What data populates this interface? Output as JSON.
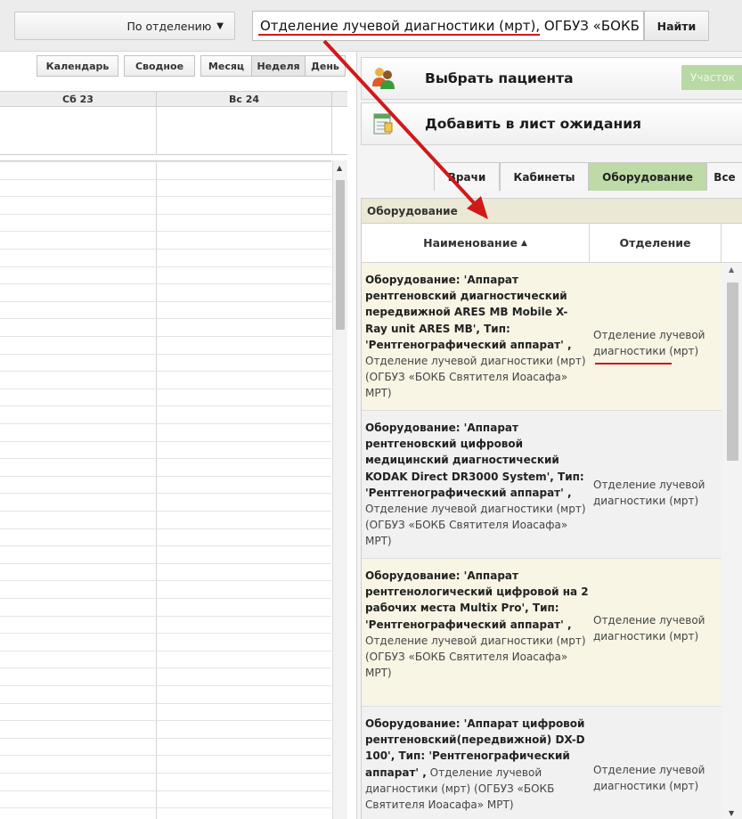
{
  "toolbar": {
    "dept_dropdown_label": "По отделению",
    "search_value": "Отделение лучевой диагностики (мрт), ОГБУЗ «БОКБ Святителя Иоасафа»",
    "find_label": "Найти"
  },
  "calendar": {
    "view_tabs": [
      "Календарь",
      "Сводное",
      "Месяц",
      "Неделя",
      "День"
    ],
    "days": [
      "Сб 23",
      "Вс 24"
    ]
  },
  "panel": {
    "select_patient": "Выбрать пациента",
    "uchastok": "Участок",
    "add_waitlist": "Добавить в лист ожидания",
    "tabs": [
      "Врачи",
      "Кабинеты",
      "Оборудование",
      "Все"
    ],
    "table_caption": "Оборудование",
    "columns": [
      "Наименование",
      "Отделение"
    ],
    "rows": [
      {
        "name": "Оборудование: 'Аппарат рентгеновский диагностический передвижной ARES MB Mobile X-Ray unit ARES MB', Тип: 'Рентгенографический аппарат' ,",
        "sub": "Отделение лучевой диагностики (мрт) (ОГБУЗ «БОКБ Святителя Иоасафа» МРТ)",
        "dept": "Отделение лучевой диагностики (мрт)"
      },
      {
        "name": "Оборудование: 'Аппарат рентгеновский цифровой медицинский диагностический KODAK Direct DR3000 System', Тип: 'Рентгенографический аппарат' ,",
        "sub": "Отделение лучевой диагностики (мрт) (ОГБУЗ «БОКБ Святителя Иоасафа» МРТ)",
        "dept": "Отделение лучевой диагностики (мрт)"
      },
      {
        "name": "Оборудование: 'Аппарат рентгенологический цифровой на 2 рабочих места Multix Pro', Тип: 'Рентгенографический аппарат' ,",
        "sub": "Отделение лучевой диагностики (мрт) (ОГБУЗ «БОКБ Святителя Иоасафа» МРТ)",
        "dept": "Отделение лучевой диагностики (мрт)"
      },
      {
        "name": "Оборудование: 'Аппарат цифровой рентгеновский(передвижной) DX-D 100', Тип: 'Рентгенографический аппарат' ,",
        "sub": "Отделение лучевой диагностики (мрт) (ОГБУЗ «БОКБ Святителя Иоасафа» МРТ)",
        "dept": "Отделение лучевой диагностики (мрт)"
      }
    ]
  },
  "colors": {
    "accent_green": "#bddaa7",
    "annotation_red": "#d01919",
    "row_odd": "#f8f5e5",
    "row_even": "#f1f1f1"
  }
}
